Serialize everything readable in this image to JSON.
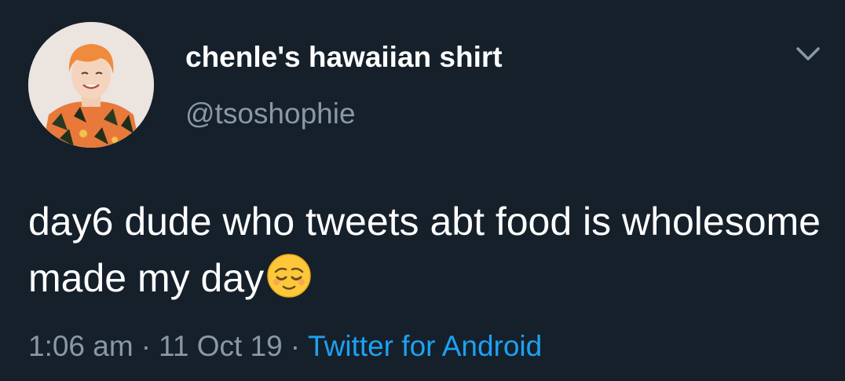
{
  "tweet": {
    "display_name": "chenle's hawaiian shirt",
    "handle": "@tsoshophie",
    "text": "day6 dude who tweets abt food is wholesome made my day",
    "emoji": "relieved-face-emoji",
    "time": "1:06 am",
    "date": "11 Oct 19",
    "separator": "·",
    "source": "Twitter for Android"
  },
  "icons": {
    "menu": "chevron-down-icon",
    "avatar": "profile-photo"
  },
  "colors": {
    "background": "#15202b",
    "primary_text": "#ffffff",
    "secondary_text": "#8899a6",
    "accent": "#1da1f2"
  }
}
